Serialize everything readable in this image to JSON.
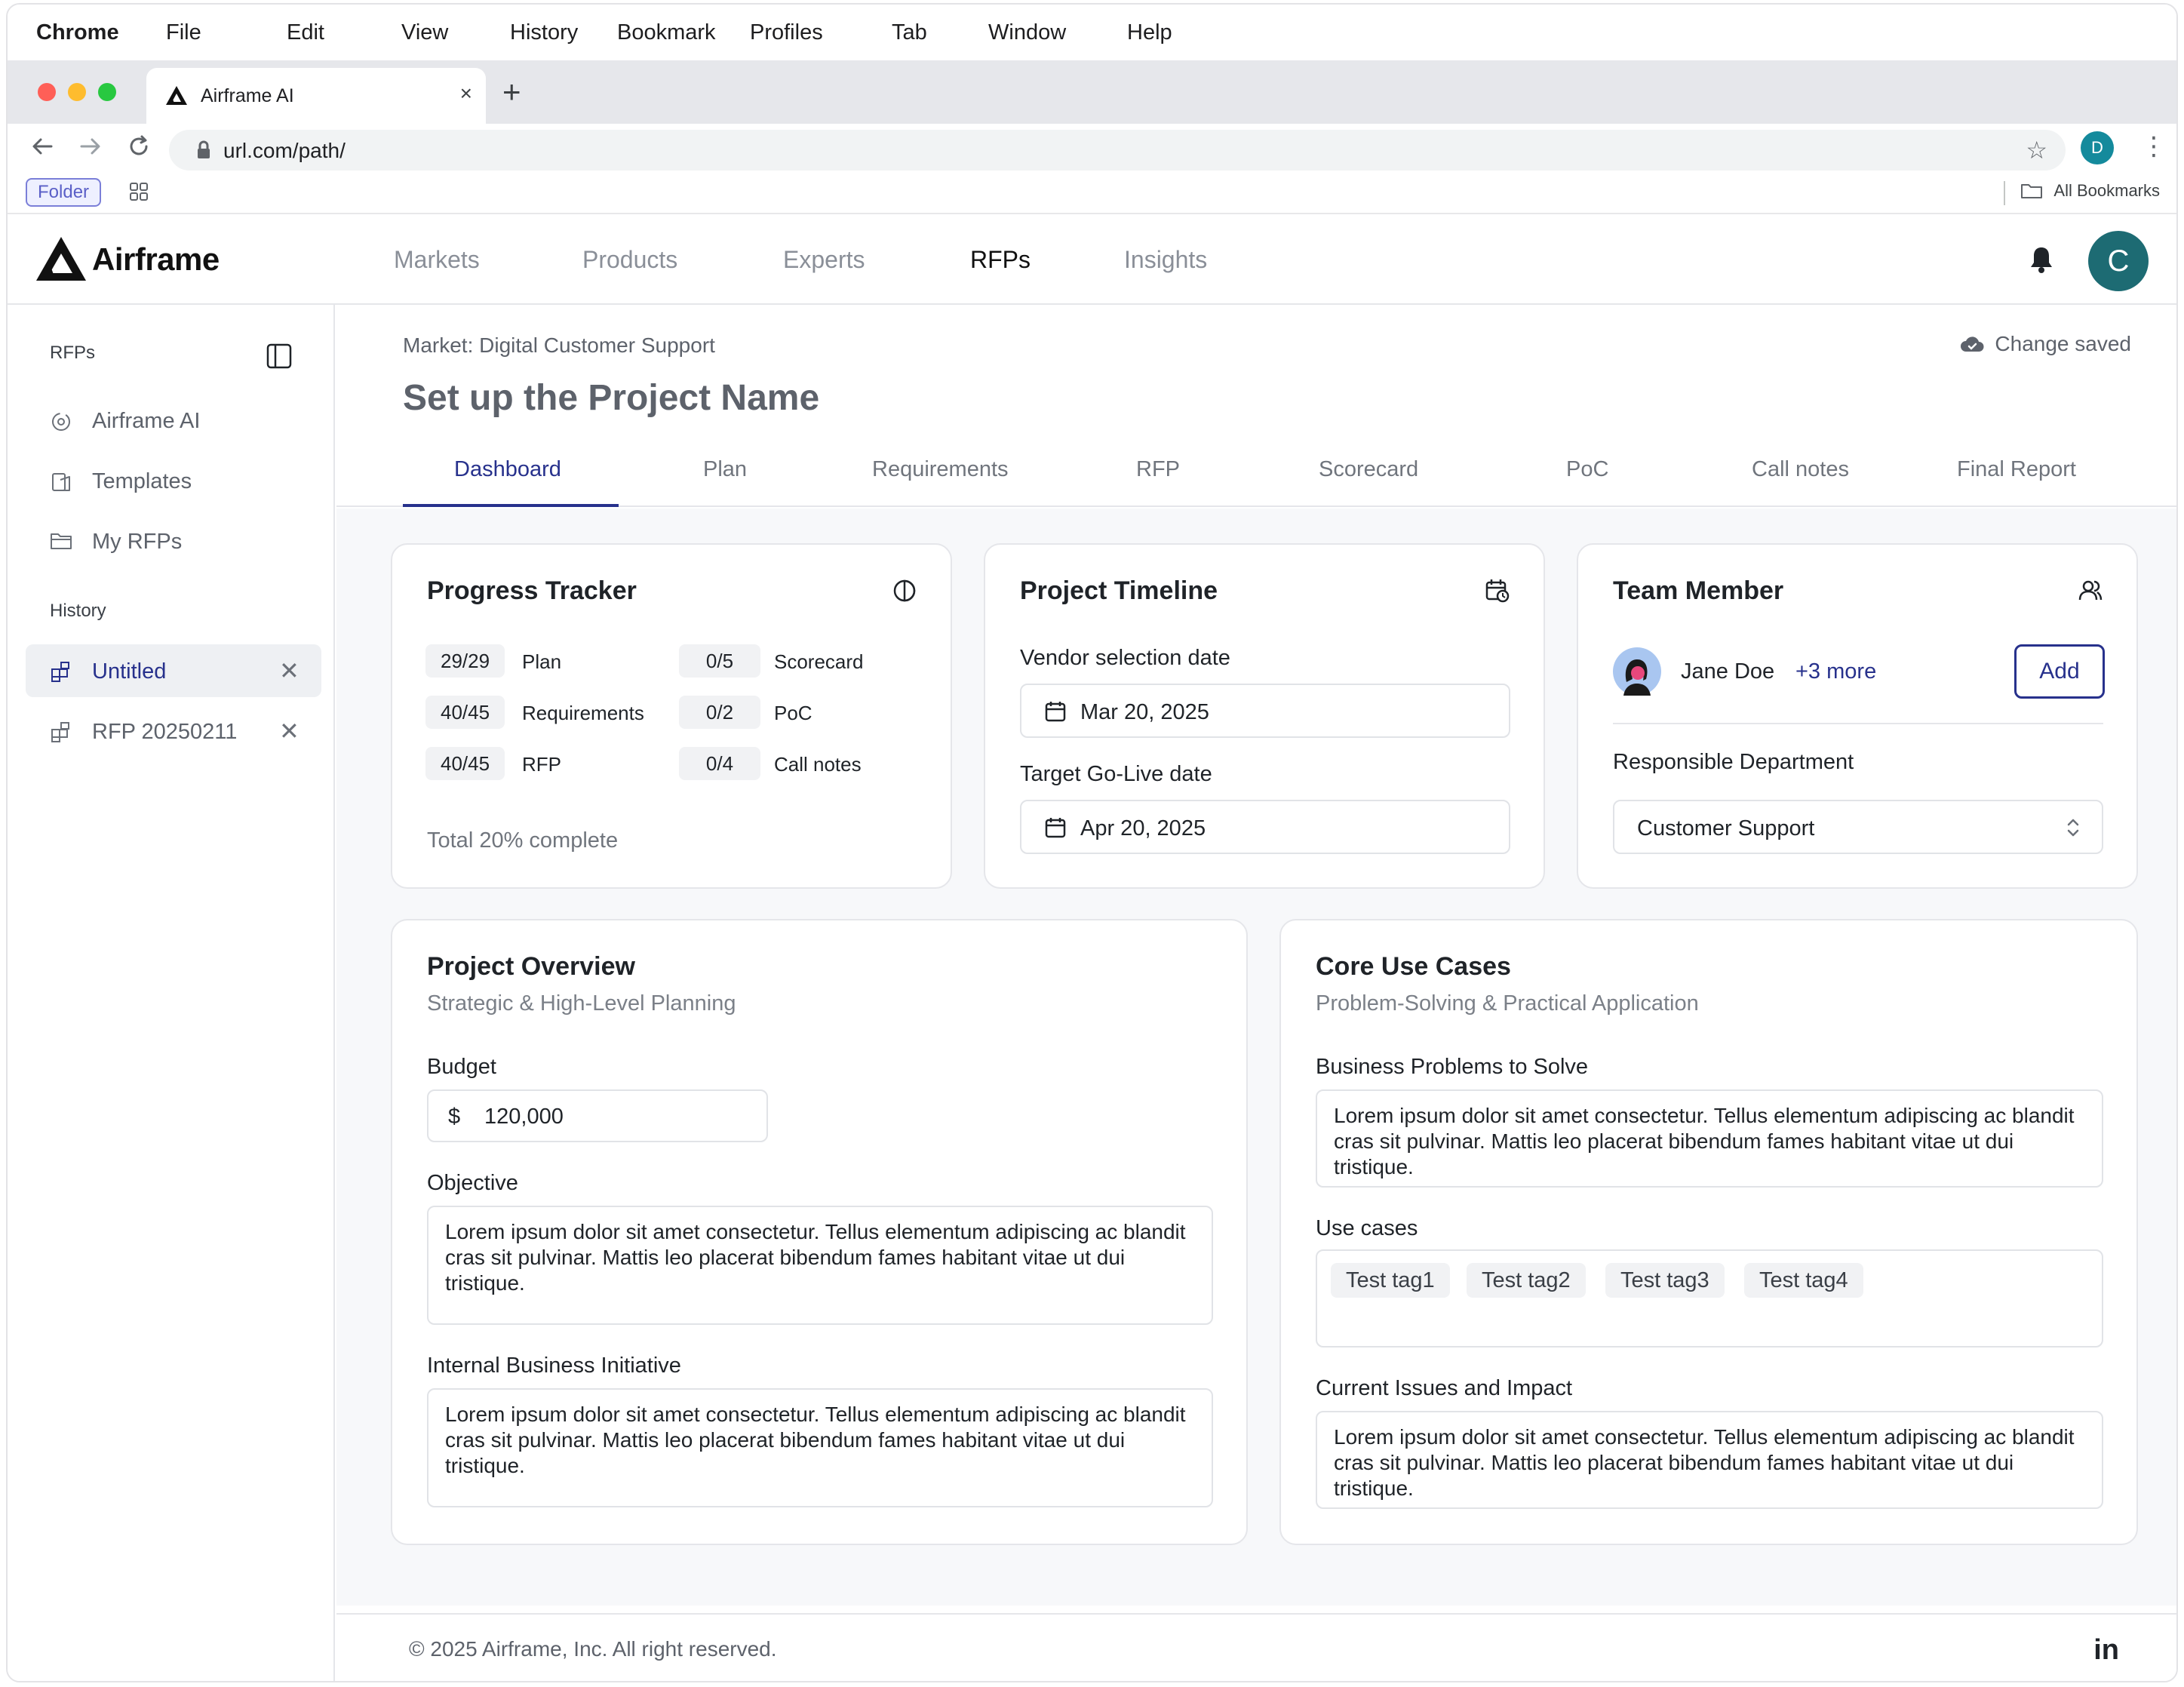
{
  "menubar": {
    "items": [
      "Chrome",
      "File",
      "Edit",
      "View",
      "History",
      "Bookmark",
      "Profiles",
      "Tab",
      "Window",
      "Help"
    ]
  },
  "browser": {
    "tab_title": "Airframe AI",
    "tab_close": "×",
    "new_tab": "+",
    "url": "url.com/path/",
    "profile_initial": "D",
    "bookmark_folder": "Folder",
    "all_bookmarks": "All Bookmarks"
  },
  "app": {
    "logo_text": "Airframe",
    "nav": [
      "Markets",
      "Products",
      "Experts",
      "RFPs",
      "Insights"
    ],
    "active_nav": "RFPs",
    "avatar_initial": "C"
  },
  "sidebar": {
    "section_rfps": "RFPs",
    "items": [
      {
        "label": "Airframe AI",
        "icon": "airframe-ai-icon"
      },
      {
        "label": "Templates",
        "icon": "templates-icon"
      },
      {
        "label": "My RFPs",
        "icon": "folder-icon"
      }
    ],
    "section_history": "History",
    "history": [
      {
        "label": "Untitled",
        "active": true
      },
      {
        "label": "RFP 20250211",
        "active": false
      }
    ],
    "close_glyph": "✕"
  },
  "main": {
    "breadcrumb": "Market: Digital Customer Support",
    "saved_status": "Change saved",
    "title": "Set up the Project Name",
    "tabs": [
      "Dashboard",
      "Plan",
      "Requirements",
      "RFP",
      "Scorecard",
      "PoC",
      "Call notes",
      "Final Report"
    ],
    "active_tab": "Dashboard"
  },
  "progress": {
    "title": "Progress Tracker",
    "rows": [
      {
        "count": "29/29",
        "label": "Plan"
      },
      {
        "count": "40/45",
        "label": "Requirements"
      },
      {
        "count": "40/45",
        "label": "RFP"
      },
      {
        "count": "0/5",
        "label": "Scorecard"
      },
      {
        "count": "0/2",
        "label": "PoC"
      },
      {
        "count": "0/4",
        "label": "Call notes"
      }
    ],
    "total": "Total 20% complete"
  },
  "timeline": {
    "title": "Project Timeline",
    "vendor_label": "Vendor selection date",
    "vendor_date": "Mar 20, 2025",
    "golive_label": "Target Go-Live date",
    "golive_date": "Apr 20, 2025"
  },
  "team": {
    "title": "Team Member",
    "member_name": "Jane Doe",
    "more": "+3 more",
    "add_button": "Add",
    "dept_label": "Responsible Department",
    "dept_value": "Customer Support"
  },
  "overview": {
    "title": "Project Overview",
    "subtitle": "Strategic & High-Level Planning",
    "budget_label": "Budget",
    "currency": "$",
    "budget_value": "120,000",
    "objective_label": "Objective",
    "objective_text": "Lorem ipsum dolor sit amet consectetur. Tellus elementum adipiscing ac blandit cras sit pulvinar. Mattis leo placerat bibendum fames habitant vitae ut dui tristique.",
    "initiative_label": "Internal Business Initiative",
    "initiative_text": "Lorem ipsum dolor sit amet consectetur. Tellus elementum adipiscing ac blandit cras sit pulvinar. Mattis leo placerat bibendum fames habitant vitae ut dui tristique."
  },
  "usecases": {
    "title": "Core Use Cases",
    "subtitle": "Problem-Solving & Practical Application",
    "problems_label": "Business Problems to Solve",
    "problems_text": "Lorem ipsum dolor sit amet consectetur. Tellus elementum adipiscing ac blandit cras sit pulvinar. Mattis leo placerat bibendum fames habitant vitae ut dui tristique.",
    "usecases_label": "Use cases",
    "tags": [
      "Test tag1",
      "Test tag2",
      "Test tag3",
      "Test tag4"
    ],
    "issues_label": "Current Issues and Impact",
    "issues_text": "Lorem ipsum dolor sit amet consectetur. Tellus elementum adipiscing ac blandit cras sit pulvinar. Mattis leo placerat bibendum fames habitant vitae ut dui tristique."
  },
  "footer": {
    "copyright": "© 2025 Airframe, Inc. All right reserved.",
    "linkedin": "in"
  },
  "colors": {
    "accent": "#27318c",
    "avatar_teal": "#1d6b73",
    "profile_teal": "#148a9c"
  }
}
